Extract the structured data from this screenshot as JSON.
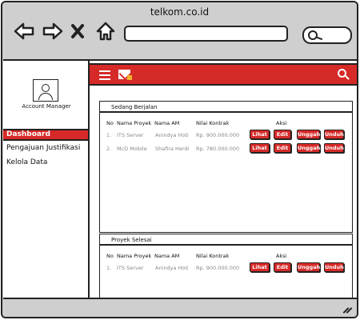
{
  "browser": {
    "url": "telkom.co.id",
    "icons": [
      "back-arrow-icon",
      "forward-arrow-icon",
      "close-icon",
      "home-icon",
      "search-icon"
    ]
  },
  "sidebar": {
    "role": "Account Manager",
    "items": [
      {
        "label": "Dashboard",
        "active": true
      },
      {
        "label": "Pengajuan Justifikasi",
        "active": false
      },
      {
        "label": "Kelola Data",
        "active": false
      }
    ]
  },
  "topbar": {
    "accent": "#d62a28",
    "icons": [
      "hamburger-icon",
      "mail-icon",
      "search-icon"
    ]
  },
  "panels": [
    {
      "title": "Sedang Berjalan",
      "columns": [
        "No",
        "Nama Proyek",
        "Nama AM",
        "Nilai Kontrak",
        "Aksi"
      ],
      "rows": [
        {
          "no": "1.",
          "proyek": "ITS Server",
          "am": "Anindya Hoti",
          "nilai": "Rp. 900.000.000"
        },
        {
          "no": "2.",
          "proyek": "McD Mobile",
          "am": "Shafira Herdi",
          "nilai": "Rp. 780.000.000"
        }
      ],
      "actions": [
        "Lihat",
        "Edit",
        "Unggah",
        "Unduh"
      ]
    },
    {
      "title": "Proyek Selesai",
      "columns": [
        "No",
        "Nama Proyek",
        "Nama AM",
        "Nilai Kontrak",
        "Aksi"
      ],
      "rows": [
        {
          "no": "1.",
          "proyek": "ITS Server",
          "am": "Anindya Hoti",
          "nilai": "Rp. 900.000.000"
        }
      ],
      "actions": [
        "Lihat",
        "Edit",
        "Unggah",
        "Unduh"
      ]
    }
  ]
}
